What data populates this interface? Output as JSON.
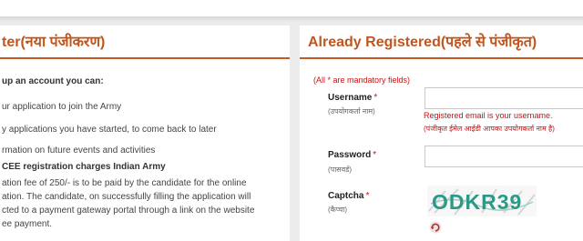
{
  "left_panel": {
    "title": "ter(नया पंजीकरण)",
    "intro": "up an account you can:",
    "bullets": [
      "ur application to join the Army",
      "y applications you have started, to come back to later",
      "rmation on future events and activities"
    ],
    "cee_heading": "CEE registration charges Indian Army",
    "fee_lines": [
      "ation fee of 250/- is to be paid by the candidate for the online",
      "ation. The candidate, on successfully filling the application will",
      "cted to a payment gateway portal through a link on the website",
      "ee payment."
    ]
  },
  "right_panel": {
    "title": "Already Registered(पहले से पंजीकृत)",
    "mandatory_note": "(All * are mandatory fields)",
    "username": {
      "label": "Username",
      "star": "*",
      "sub_label": "(उपयोगकर्ता नाम)",
      "value": "",
      "hint_en": "Registered email is your username.",
      "hint_hi": "(पंजीकृत ईमेल आईडी आपका उपयोगकर्ता नाम है)"
    },
    "password": {
      "label": "Password",
      "star": "*",
      "sub_label": "(पासवर्ड)",
      "value": ""
    },
    "captcha": {
      "label": "Captcha",
      "star": "*",
      "sub_label": "(कैप्चा)",
      "text": "ODKR39"
    },
    "refresh_icon": "refresh-icon"
  },
  "colors": {
    "accent": "#c0561f",
    "rule": "#c65a25",
    "error": "#cc1111",
    "captcha_text": "#2a9a86"
  }
}
